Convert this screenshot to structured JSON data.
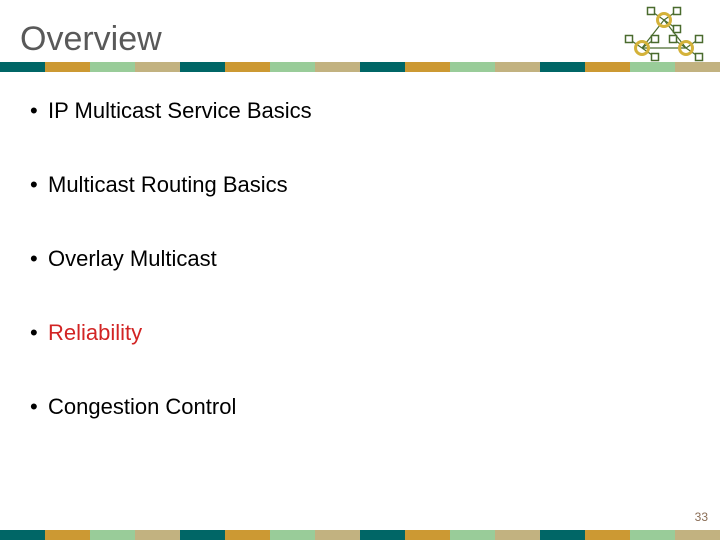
{
  "title": "Overview",
  "bullets": [
    {
      "text": "IP Multicast Service Basics",
      "highlight": false
    },
    {
      "text": "Multicast Routing Basics",
      "highlight": false
    },
    {
      "text": "Overlay Multicast",
      "highlight": false
    },
    {
      "text": "Reliability",
      "highlight": true
    },
    {
      "text": "Congestion Control",
      "highlight": false
    }
  ],
  "page_number": "33",
  "stripe_colors": [
    "#006666",
    "#cc9933",
    "#99cc99",
    "#c2b280",
    "#006666",
    "#cc9933",
    "#99cc99",
    "#c2b280",
    "#006666",
    "#cc9933",
    "#99cc99",
    "#c2b280",
    "#006666",
    "#cc9933",
    "#99cc99",
    "#c2b280"
  ],
  "diagram_colors": {
    "ring": "#d4b23a",
    "box_stroke": "#4a6b2e",
    "box_fill": "#ffffff",
    "link": "#4a6b2e"
  }
}
